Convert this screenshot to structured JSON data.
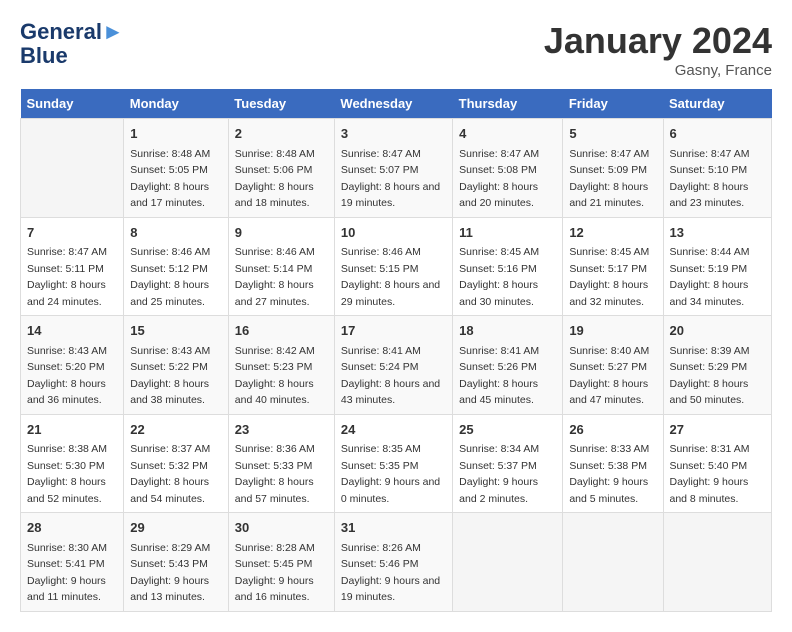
{
  "header": {
    "logo_line1": "General",
    "logo_line2": "Blue",
    "month_title": "January 2024",
    "location": "Gasny, France"
  },
  "weekdays": [
    "Sunday",
    "Monday",
    "Tuesday",
    "Wednesday",
    "Thursday",
    "Friday",
    "Saturday"
  ],
  "weeks": [
    [
      {
        "day": "",
        "sunrise": "",
        "sunset": "",
        "daylight": ""
      },
      {
        "day": "1",
        "sunrise": "Sunrise: 8:48 AM",
        "sunset": "Sunset: 5:05 PM",
        "daylight": "Daylight: 8 hours and 17 minutes."
      },
      {
        "day": "2",
        "sunrise": "Sunrise: 8:48 AM",
        "sunset": "Sunset: 5:06 PM",
        "daylight": "Daylight: 8 hours and 18 minutes."
      },
      {
        "day": "3",
        "sunrise": "Sunrise: 8:47 AM",
        "sunset": "Sunset: 5:07 PM",
        "daylight": "Daylight: 8 hours and 19 minutes."
      },
      {
        "day": "4",
        "sunrise": "Sunrise: 8:47 AM",
        "sunset": "Sunset: 5:08 PM",
        "daylight": "Daylight: 8 hours and 20 minutes."
      },
      {
        "day": "5",
        "sunrise": "Sunrise: 8:47 AM",
        "sunset": "Sunset: 5:09 PM",
        "daylight": "Daylight: 8 hours and 21 minutes."
      },
      {
        "day": "6",
        "sunrise": "Sunrise: 8:47 AM",
        "sunset": "Sunset: 5:10 PM",
        "daylight": "Daylight: 8 hours and 23 minutes."
      }
    ],
    [
      {
        "day": "7",
        "sunrise": "Sunrise: 8:47 AM",
        "sunset": "Sunset: 5:11 PM",
        "daylight": "Daylight: 8 hours and 24 minutes."
      },
      {
        "day": "8",
        "sunrise": "Sunrise: 8:46 AM",
        "sunset": "Sunset: 5:12 PM",
        "daylight": "Daylight: 8 hours and 25 minutes."
      },
      {
        "day": "9",
        "sunrise": "Sunrise: 8:46 AM",
        "sunset": "Sunset: 5:14 PM",
        "daylight": "Daylight: 8 hours and 27 minutes."
      },
      {
        "day": "10",
        "sunrise": "Sunrise: 8:46 AM",
        "sunset": "Sunset: 5:15 PM",
        "daylight": "Daylight: 8 hours and 29 minutes."
      },
      {
        "day": "11",
        "sunrise": "Sunrise: 8:45 AM",
        "sunset": "Sunset: 5:16 PM",
        "daylight": "Daylight: 8 hours and 30 minutes."
      },
      {
        "day": "12",
        "sunrise": "Sunrise: 8:45 AM",
        "sunset": "Sunset: 5:17 PM",
        "daylight": "Daylight: 8 hours and 32 minutes."
      },
      {
        "day": "13",
        "sunrise": "Sunrise: 8:44 AM",
        "sunset": "Sunset: 5:19 PM",
        "daylight": "Daylight: 8 hours and 34 minutes."
      }
    ],
    [
      {
        "day": "14",
        "sunrise": "Sunrise: 8:43 AM",
        "sunset": "Sunset: 5:20 PM",
        "daylight": "Daylight: 8 hours and 36 minutes."
      },
      {
        "day": "15",
        "sunrise": "Sunrise: 8:43 AM",
        "sunset": "Sunset: 5:22 PM",
        "daylight": "Daylight: 8 hours and 38 minutes."
      },
      {
        "day": "16",
        "sunrise": "Sunrise: 8:42 AM",
        "sunset": "Sunset: 5:23 PM",
        "daylight": "Daylight: 8 hours and 40 minutes."
      },
      {
        "day": "17",
        "sunrise": "Sunrise: 8:41 AM",
        "sunset": "Sunset: 5:24 PM",
        "daylight": "Daylight: 8 hours and 43 minutes."
      },
      {
        "day": "18",
        "sunrise": "Sunrise: 8:41 AM",
        "sunset": "Sunset: 5:26 PM",
        "daylight": "Daylight: 8 hours and 45 minutes."
      },
      {
        "day": "19",
        "sunrise": "Sunrise: 8:40 AM",
        "sunset": "Sunset: 5:27 PM",
        "daylight": "Daylight: 8 hours and 47 minutes."
      },
      {
        "day": "20",
        "sunrise": "Sunrise: 8:39 AM",
        "sunset": "Sunset: 5:29 PM",
        "daylight": "Daylight: 8 hours and 50 minutes."
      }
    ],
    [
      {
        "day": "21",
        "sunrise": "Sunrise: 8:38 AM",
        "sunset": "Sunset: 5:30 PM",
        "daylight": "Daylight: 8 hours and 52 minutes."
      },
      {
        "day": "22",
        "sunrise": "Sunrise: 8:37 AM",
        "sunset": "Sunset: 5:32 PM",
        "daylight": "Daylight: 8 hours and 54 minutes."
      },
      {
        "day": "23",
        "sunrise": "Sunrise: 8:36 AM",
        "sunset": "Sunset: 5:33 PM",
        "daylight": "Daylight: 8 hours and 57 minutes."
      },
      {
        "day": "24",
        "sunrise": "Sunrise: 8:35 AM",
        "sunset": "Sunset: 5:35 PM",
        "daylight": "Daylight: 9 hours and 0 minutes."
      },
      {
        "day": "25",
        "sunrise": "Sunrise: 8:34 AM",
        "sunset": "Sunset: 5:37 PM",
        "daylight": "Daylight: 9 hours and 2 minutes."
      },
      {
        "day": "26",
        "sunrise": "Sunrise: 8:33 AM",
        "sunset": "Sunset: 5:38 PM",
        "daylight": "Daylight: 9 hours and 5 minutes."
      },
      {
        "day": "27",
        "sunrise": "Sunrise: 8:31 AM",
        "sunset": "Sunset: 5:40 PM",
        "daylight": "Daylight: 9 hours and 8 minutes."
      }
    ],
    [
      {
        "day": "28",
        "sunrise": "Sunrise: 8:30 AM",
        "sunset": "Sunset: 5:41 PM",
        "daylight": "Daylight: 9 hours and 11 minutes."
      },
      {
        "day": "29",
        "sunrise": "Sunrise: 8:29 AM",
        "sunset": "Sunset: 5:43 PM",
        "daylight": "Daylight: 9 hours and 13 minutes."
      },
      {
        "day": "30",
        "sunrise": "Sunrise: 8:28 AM",
        "sunset": "Sunset: 5:45 PM",
        "daylight": "Daylight: 9 hours and 16 minutes."
      },
      {
        "day": "31",
        "sunrise": "Sunrise: 8:26 AM",
        "sunset": "Sunset: 5:46 PM",
        "daylight": "Daylight: 9 hours and 19 minutes."
      },
      {
        "day": "",
        "sunrise": "",
        "sunset": "",
        "daylight": ""
      },
      {
        "day": "",
        "sunrise": "",
        "sunset": "",
        "daylight": ""
      },
      {
        "day": "",
        "sunrise": "",
        "sunset": "",
        "daylight": ""
      }
    ]
  ]
}
